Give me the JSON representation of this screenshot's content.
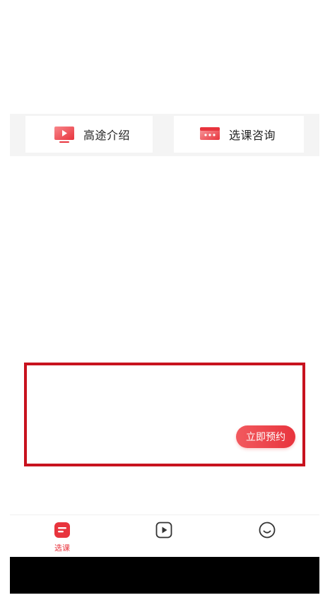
{
  "quick_links": {
    "intro_label": "高途介绍",
    "consult_label": "选课咨询"
  },
  "promo": {
    "reserve_label": "立即预约"
  },
  "bottom_nav": {
    "tabs": [
      {
        "label": "选课",
        "icon": "course-select-icon",
        "active": true
      },
      {
        "label": "",
        "icon": "play-video-icon",
        "active": false
      },
      {
        "label": "",
        "icon": "smile-profile-icon",
        "active": false
      }
    ]
  },
  "colors": {
    "accent": "#e8343d",
    "highlight_border": "#c8121e",
    "strip_bg": "#f4f4f4",
    "system_bar": "#000000"
  }
}
